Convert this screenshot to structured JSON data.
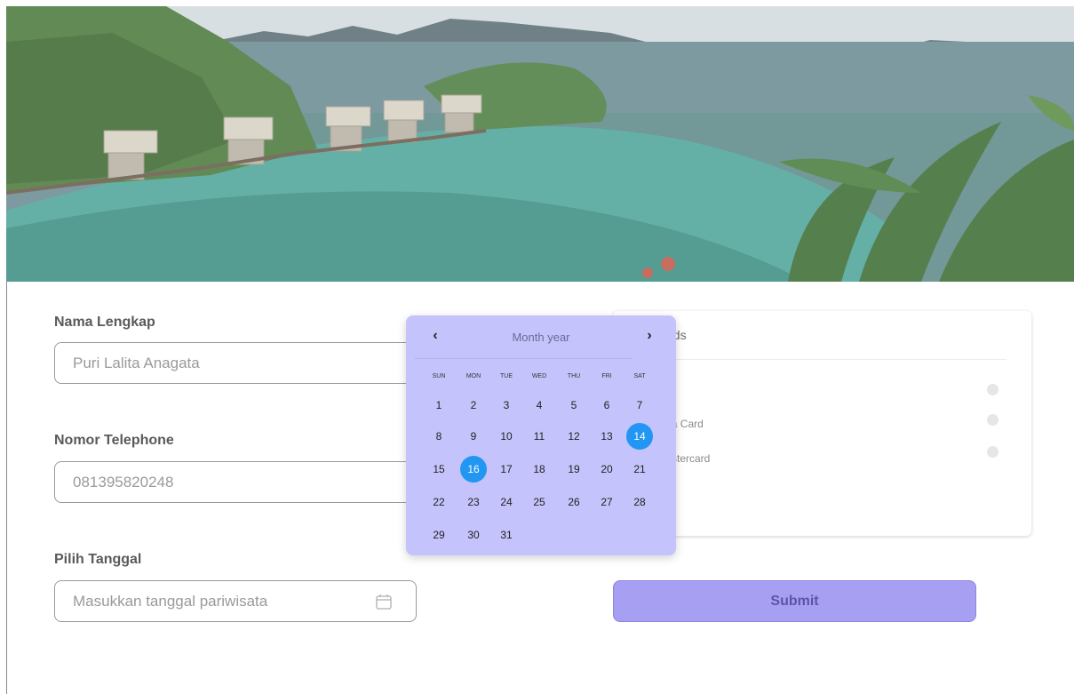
{
  "form": {
    "name_label": "Nama Lengkap",
    "name_value": "Puri Lalita Anagata",
    "phone_label": "Nomor Telephone",
    "phone_value": "081395820248",
    "date_label": "Pilih Tanggal",
    "date_placeholder": "Masukkan tanggal pariwisata",
    "date_icon": "calendar-icon"
  },
  "payment": {
    "title_visible": "ods",
    "options": [
      {
        "label": ""
      },
      {
        "label": "it Visa Card"
      },
      {
        "label": "it Mastercard"
      }
    ]
  },
  "submit_label": "Submit",
  "datepicker": {
    "prev_label": "‹",
    "next_label": "›",
    "title": "Month year",
    "weekdays": [
      "SUN",
      "MON",
      "TUE",
      "WED",
      "THU",
      "FRI",
      "SAT"
    ],
    "weeks": [
      [
        1,
        2,
        3,
        4,
        5,
        6,
        7
      ],
      [
        8,
        9,
        10,
        11,
        12,
        13,
        14
      ],
      [
        15,
        16,
        17,
        18,
        19,
        20,
        21
      ],
      [
        22,
        23,
        24,
        25,
        26,
        27,
        28
      ],
      [
        29,
        30,
        31
      ]
    ],
    "selected_days": [
      14,
      16
    ],
    "accent_color": "#2196f3",
    "background_color": "#c5c3fb"
  },
  "colors": {
    "submit_bg": "#a7a0f2"
  }
}
